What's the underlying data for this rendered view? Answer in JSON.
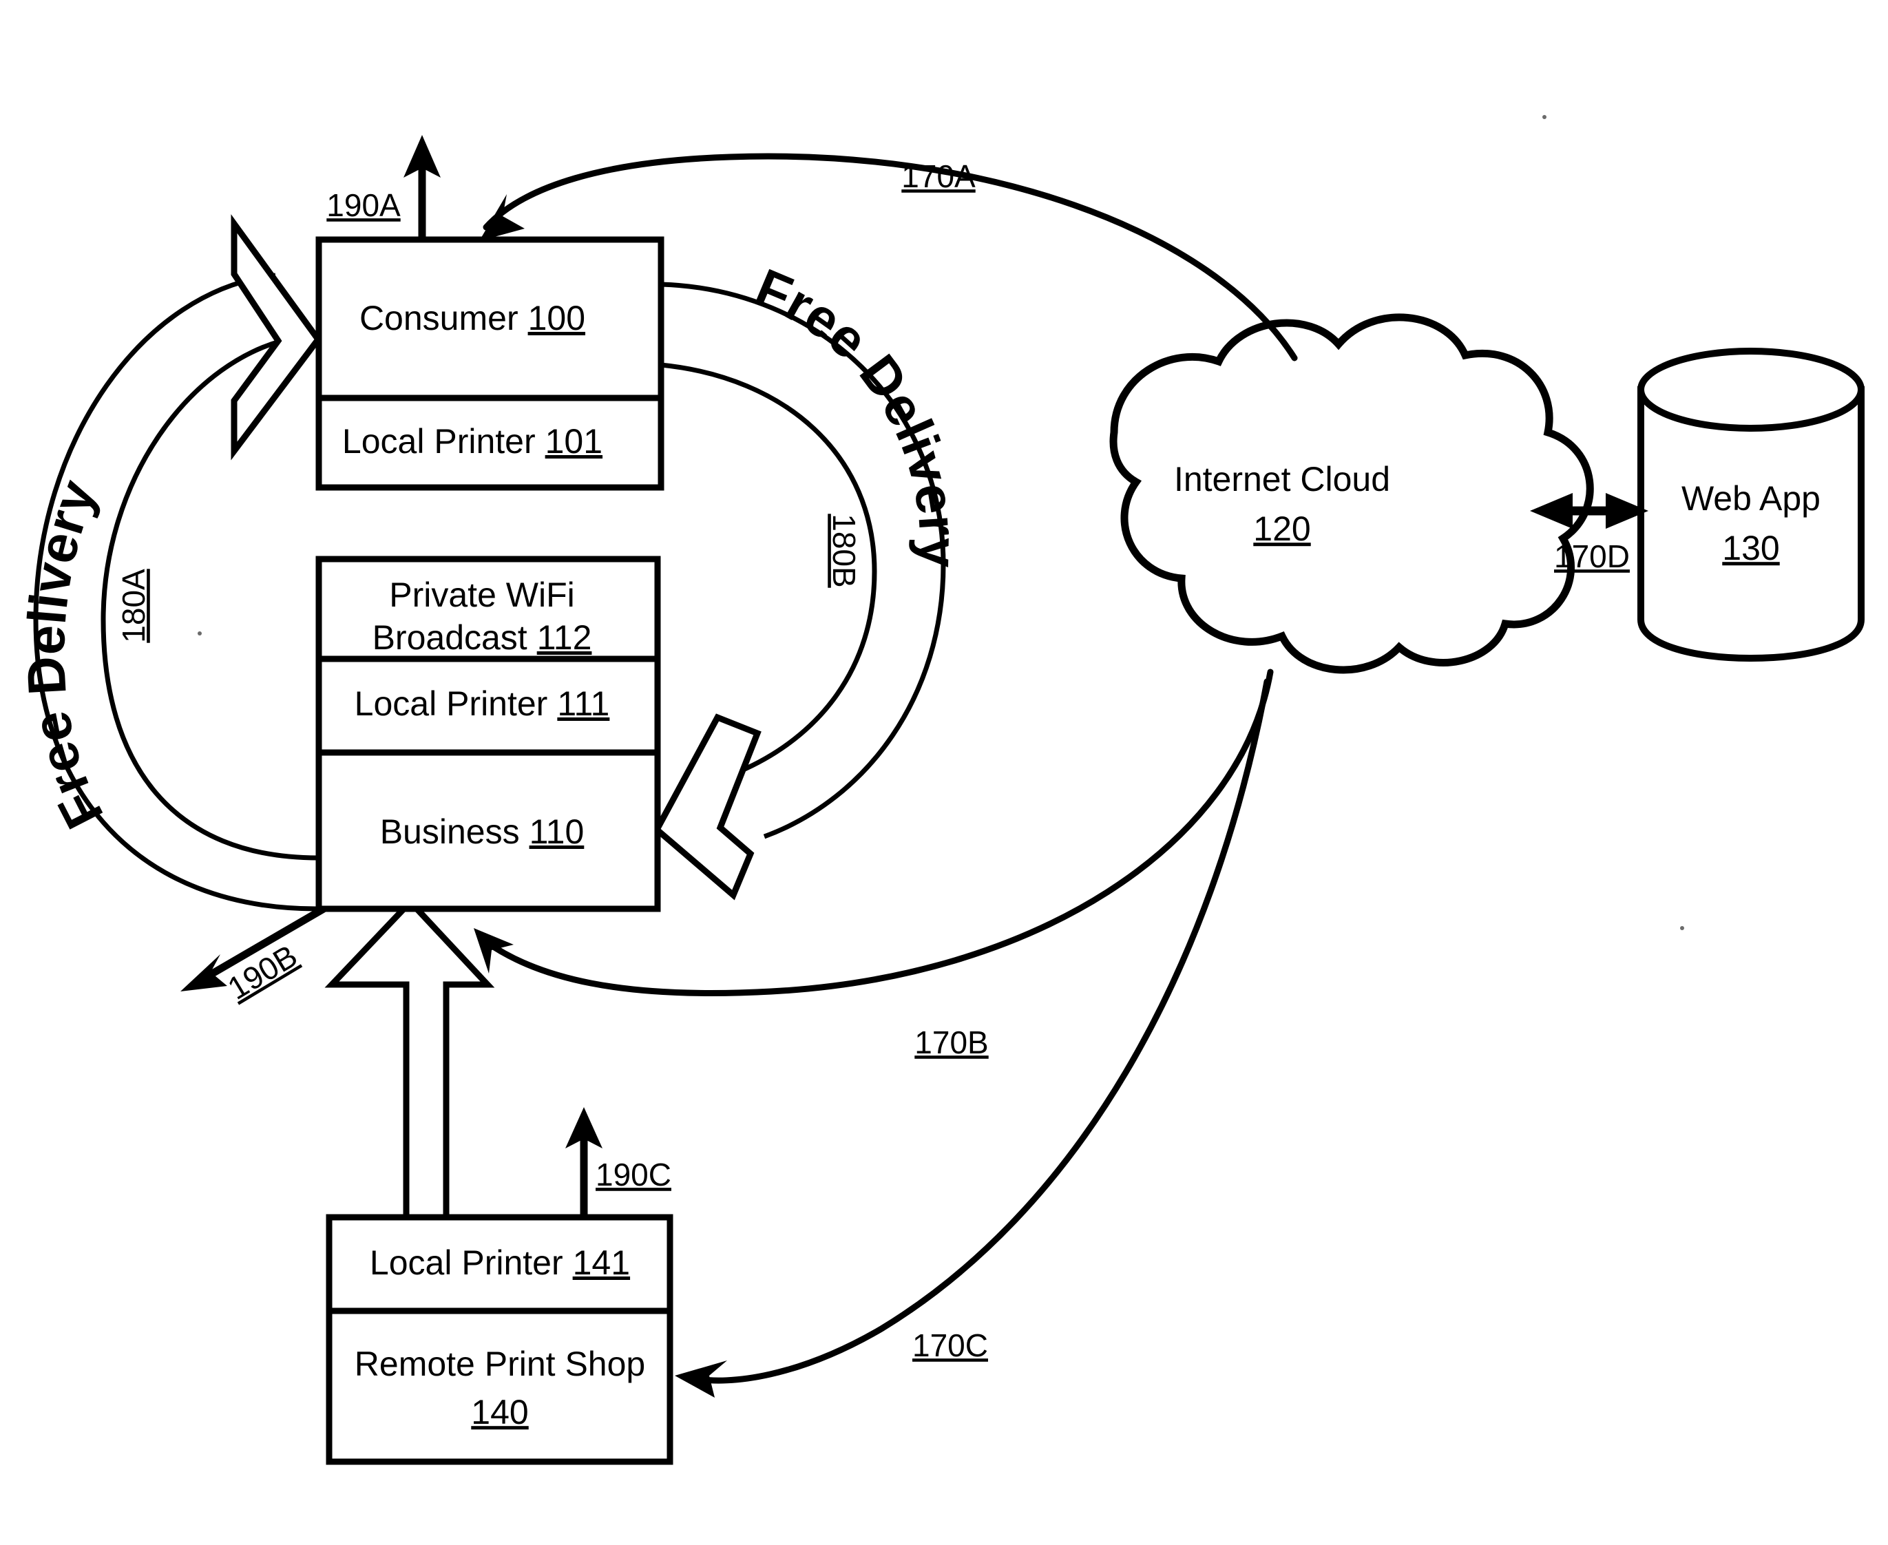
{
  "figure": {
    "type": "patent-system-diagram",
    "background": "#ffffff",
    "ink": "#000000"
  },
  "nodes": {
    "consumer": {
      "title": "Consumer",
      "ref": "100",
      "sub_title": "Local Printer",
      "sub_ref": "101"
    },
    "business": {
      "wifi_line1": "Private WiFi",
      "wifi_line2": "Broadcast",
      "wifi_ref": "112",
      "printer_title": "Local Printer",
      "printer_ref": "111",
      "title": "Business",
      "ref": "110"
    },
    "print_shop": {
      "printer_title": "Local Printer",
      "printer_ref": "141",
      "title_line1": "Remote Print Shop",
      "ref": "140"
    },
    "cloud": {
      "title": "Internet Cloud",
      "ref": "120"
    },
    "web_app": {
      "title": "Web App",
      "ref": "130"
    }
  },
  "connectors": {
    "c170a": {
      "label": "170A",
      "from": "Internet Cloud 120",
      "to": "Consumer 100"
    },
    "c170b": {
      "label": "170B",
      "from": "Internet Cloud 120",
      "to": "Business 110"
    },
    "c170c": {
      "label": "170C",
      "from": "Internet Cloud 120",
      "to": "Remote Print Shop 140"
    },
    "c170d": {
      "label": "170D",
      "from": "Internet Cloud 120",
      "to": "Web App 130"
    },
    "c180a": {
      "label": "180A",
      "text": "Free Delivery",
      "from": "Business 110",
      "to": "Consumer 100"
    },
    "c180b": {
      "label": "180B",
      "text": "Free Delivery",
      "from": "Consumer 100",
      "to": "Business 110"
    },
    "c190a": {
      "label": "190A",
      "from": "Consumer 100",
      "to": "out"
    },
    "c190b": {
      "label": "190B",
      "from": "Business 110",
      "to": "out"
    },
    "c190c": {
      "label": "190C",
      "from": "Remote Print Shop 140",
      "to": "out"
    },
    "print_shop_to_business": {
      "label": "",
      "from": "Remote Print Shop 140",
      "to": "Business 110"
    }
  }
}
